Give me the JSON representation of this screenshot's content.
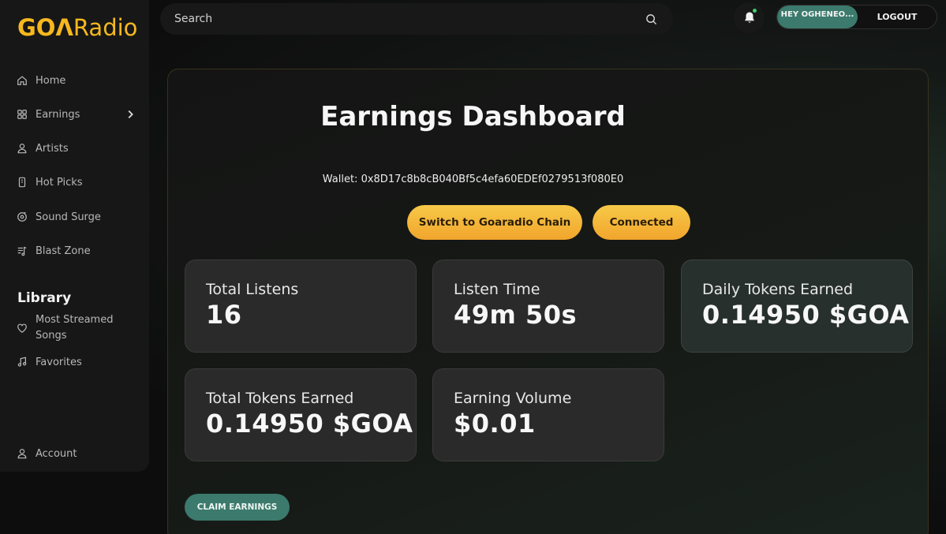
{
  "brand": {
    "logo_bold": "GOΛ",
    "logo_rest": "Radio",
    "accent": "#f6b81e",
    "teal": "#3b7a6c"
  },
  "sidebar": {
    "items": [
      {
        "label": "Home",
        "icon": "home-icon"
      },
      {
        "label": "Earnings",
        "icon": "grid-icon"
      },
      {
        "label": "Artists",
        "icon": "user-icon"
      },
      {
        "label": "Hot Picks",
        "icon": "phone-icon"
      },
      {
        "label": "Sound Surge",
        "icon": "disc-icon"
      },
      {
        "label": "Blast Zone",
        "icon": "playlist-icon"
      }
    ],
    "library_title": "Library",
    "library_items": [
      {
        "label": "Most Streamed Songs",
        "icon": "heart-icon"
      },
      {
        "label": "Favorites",
        "icon": "music-note-icon"
      }
    ],
    "account": {
      "label": "Account",
      "icon": "user-icon"
    }
  },
  "topbar": {
    "search_placeholder": "Search",
    "user_label": "HEY OGHENEO...",
    "logout_label": "LOGOUT"
  },
  "dashboard": {
    "title": "Earnings Dashboard",
    "wallet": "Wallet: 0x8D17c8b8cB040Bf5c4efa60EDEf0279513f080E0",
    "switch_chain_label": "Switch to Goaradio Chain",
    "connected_label": "Connected",
    "cards": [
      {
        "label": "Total Listens",
        "value": "16"
      },
      {
        "label": "Listen Time",
        "value": "49m 50s"
      },
      {
        "label": "Daily Tokens Earned",
        "value": "0.14950 $GOA"
      },
      {
        "label": "Total Tokens Earned",
        "value": "0.14950 $GOA"
      },
      {
        "label": "Earning Volume",
        "value": "$0.01"
      }
    ],
    "claim_label": "CLAIM EARNINGS"
  }
}
